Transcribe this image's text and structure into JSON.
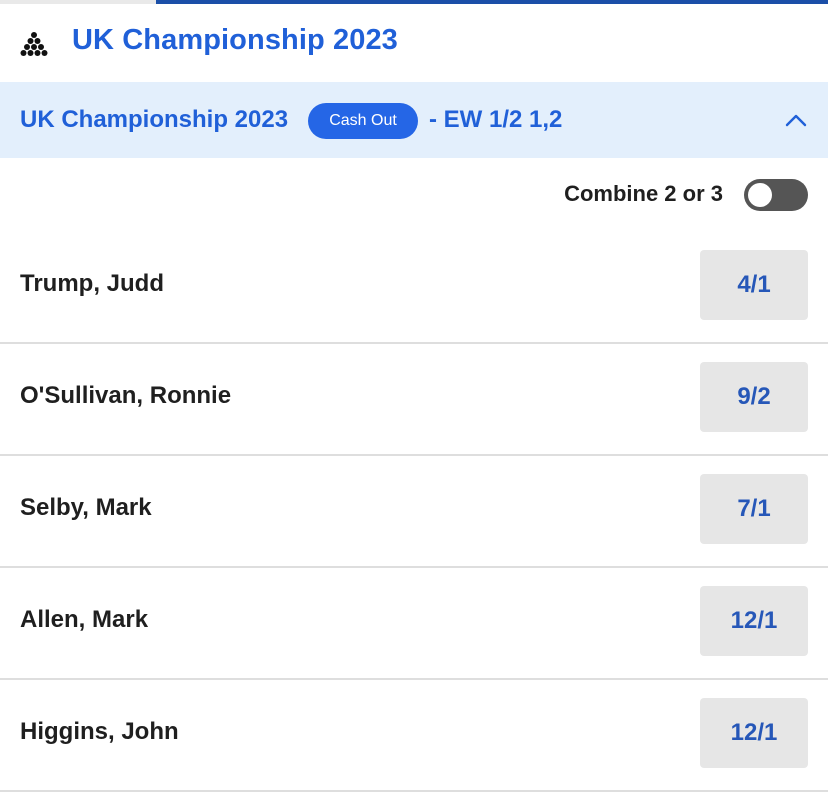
{
  "sport": {
    "icon": "snooker-balls-icon",
    "title": "UK Championship 2023"
  },
  "market": {
    "title": "UK Championship 2023",
    "cashout_label": "Cash Out",
    "ew_terms": "- EW 1/2 1,2",
    "chevron": "chevron-up-icon"
  },
  "combine": {
    "label": "Combine 2 or 3",
    "enabled": false
  },
  "runners": [
    {
      "name": "Trump, Judd",
      "odds": "4/1"
    },
    {
      "name": "O'Sullivan, Ronnie",
      "odds": "9/2"
    },
    {
      "name": "Selby, Mark",
      "odds": "7/1"
    },
    {
      "name": "Allen, Mark",
      "odds": "12/1"
    },
    {
      "name": "Higgins, John",
      "odds": "12/1"
    }
  ],
  "colors": {
    "brand_blue": "#2060d8",
    "badge_blue": "#2566e6",
    "header_bg": "#e3effc",
    "odds_bg": "#e6e6e6",
    "odds_text": "#2657b8"
  }
}
